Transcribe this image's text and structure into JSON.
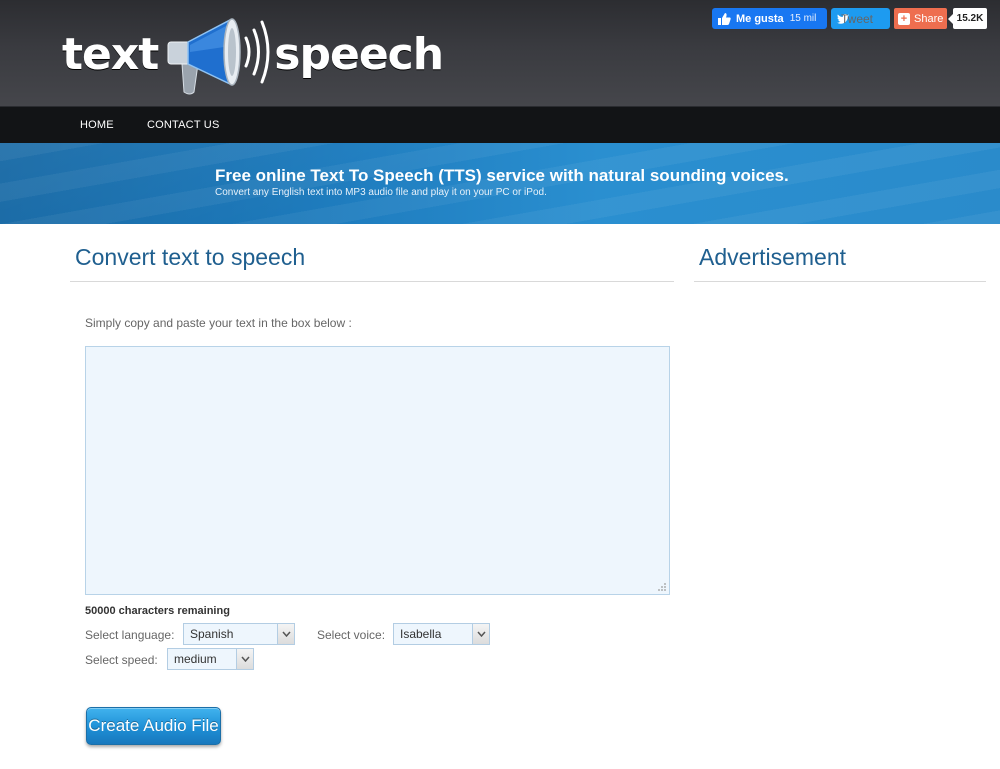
{
  "logo": {
    "word_left": "text",
    "word_right": "speech",
    "icon": "megaphone-icon"
  },
  "nav": {
    "items": [
      {
        "label": "HOME"
      },
      {
        "label": "CONTACT US"
      }
    ]
  },
  "social": {
    "facebook": {
      "label": "Me gusta",
      "count": "15 mil",
      "icon": "thumbs-up-icon",
      "color": "#1877f2"
    },
    "twitter": {
      "label": "Tweet",
      "icon": "twitter-bird-icon",
      "color": "#1d9bf0"
    },
    "share": {
      "label": "Share",
      "count": "15.2K",
      "icon": "plus-icon",
      "color": "#ee6e4f"
    }
  },
  "banner": {
    "title": "Free online Text To Speech (TTS) service with natural sounding voices.",
    "subtitle": "Convert any English text into MP3 audio file and play it on your PC or iPod."
  },
  "main": {
    "title": "Convert text to speech",
    "instructions": "Simply copy and paste your text in the box below :",
    "textarea_value": "",
    "remaining": "50000 characters remaining",
    "language": {
      "label": "Select language:",
      "value": "Spanish"
    },
    "voice": {
      "label": "Select voice:",
      "value": "Isabella"
    },
    "speed": {
      "label": "Select speed:",
      "value": "medium"
    },
    "create_button": "Create Audio File"
  },
  "sidebar": {
    "title": "Advertisement"
  },
  "colors": {
    "accent": "#1f5f8f",
    "header": "#3a3b40",
    "navbar": "#121416",
    "banner": "#1f7dbf",
    "button": "#1e8fd6"
  }
}
